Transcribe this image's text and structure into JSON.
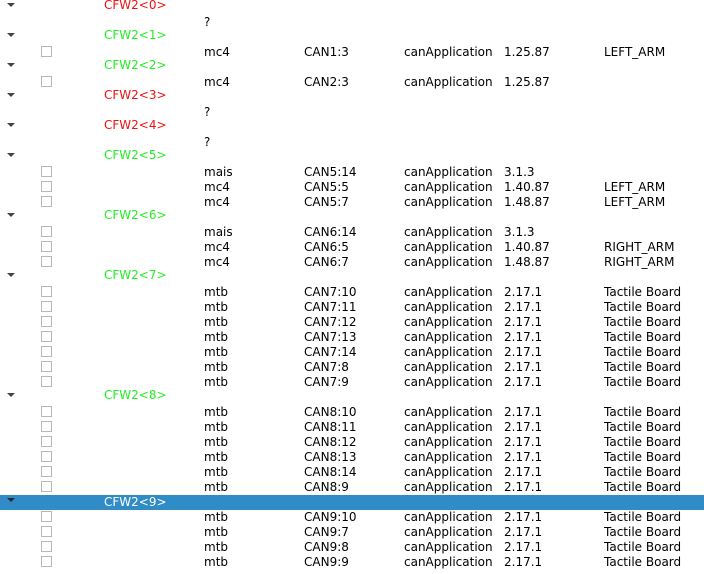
{
  "colors": {
    "group_ok": "#22ee22",
    "group_missing": "#ee1111",
    "selection": "#308cc6"
  },
  "groups": [
    {
      "label": "CFW2<0>",
      "status": "missing",
      "selected": false,
      "devices": [
        {
          "checkbox": false,
          "type": "?",
          "address": "",
          "application": "",
          "version": "",
          "name": ""
        }
      ]
    },
    {
      "label": "CFW2<1>",
      "status": "ok",
      "selected": false,
      "devices": [
        {
          "checkbox": true,
          "type": "mc4",
          "address": "CAN1:3",
          "application": "canApplication",
          "version": "1.25.87",
          "name": "LEFT_ARM"
        }
      ]
    },
    {
      "label": "CFW2<2>",
      "status": "ok",
      "selected": false,
      "devices": [
        {
          "checkbox": true,
          "type": "mc4",
          "address": "CAN2:3",
          "application": "canApplication",
          "version": "1.25.87",
          "name": ""
        }
      ]
    },
    {
      "label": "CFW2<3>",
      "status": "missing",
      "selected": false,
      "devices": [
        {
          "checkbox": false,
          "type": "?",
          "address": "",
          "application": "",
          "version": "",
          "name": ""
        }
      ]
    },
    {
      "label": "CFW2<4>",
      "status": "missing",
      "selected": false,
      "devices": [
        {
          "checkbox": false,
          "type": "?",
          "address": "",
          "application": "",
          "version": "",
          "name": ""
        }
      ]
    },
    {
      "label": "CFW2<5>",
      "status": "ok",
      "selected": false,
      "devices": [
        {
          "checkbox": true,
          "type": "mais",
          "address": "CAN5:14",
          "application": "canApplication",
          "version": "3.1.3",
          "name": ""
        },
        {
          "checkbox": true,
          "type": "mc4",
          "address": "CAN5:5",
          "application": "canApplication",
          "version": "1.40.87",
          "name": "LEFT_ARM"
        },
        {
          "checkbox": true,
          "type": "mc4",
          "address": "CAN5:7",
          "application": "canApplication",
          "version": "1.48.87",
          "name": "LEFT_ARM"
        }
      ]
    },
    {
      "label": "CFW2<6>",
      "status": "ok",
      "selected": false,
      "devices": [
        {
          "checkbox": true,
          "type": "mais",
          "address": "CAN6:14",
          "application": "canApplication",
          "version": "3.1.3",
          "name": ""
        },
        {
          "checkbox": true,
          "type": "mc4",
          "address": "CAN6:5",
          "application": "canApplication",
          "version": "1.40.87",
          "name": "RIGHT_ARM"
        },
        {
          "checkbox": true,
          "type": "mc4",
          "address": "CAN6:7",
          "application": "canApplication",
          "version": "1.48.87",
          "name": "RIGHT_ARM"
        }
      ]
    },
    {
      "label": "CFW2<7>",
      "status": "ok",
      "selected": false,
      "devices": [
        {
          "checkbox": true,
          "type": "mtb",
          "address": "CAN7:10",
          "application": "canApplication",
          "version": "2.17.1",
          "name": "Tactile Board"
        },
        {
          "checkbox": true,
          "type": "mtb",
          "address": "CAN7:11",
          "application": "canApplication",
          "version": "2.17.1",
          "name": "Tactile Board"
        },
        {
          "checkbox": true,
          "type": "mtb",
          "address": "CAN7:12",
          "application": "canApplication",
          "version": "2.17.1",
          "name": "Tactile Board"
        },
        {
          "checkbox": true,
          "type": "mtb",
          "address": "CAN7:13",
          "application": "canApplication",
          "version": "2.17.1",
          "name": "Tactile Board"
        },
        {
          "checkbox": true,
          "type": "mtb",
          "address": "CAN7:14",
          "application": "canApplication",
          "version": "2.17.1",
          "name": "Tactile Board"
        },
        {
          "checkbox": true,
          "type": "mtb",
          "address": "CAN7:8",
          "application": "canApplication",
          "version": "2.17.1",
          "name": "Tactile Board"
        },
        {
          "checkbox": true,
          "type": "mtb",
          "address": "CAN7:9",
          "application": "canApplication",
          "version": "2.17.1",
          "name": "Tactile Board"
        }
      ]
    },
    {
      "label": "CFW2<8>",
      "status": "ok",
      "selected": false,
      "devices": [
        {
          "checkbox": true,
          "type": "mtb",
          "address": "CAN8:10",
          "application": "canApplication",
          "version": "2.17.1",
          "name": "Tactile Board"
        },
        {
          "checkbox": true,
          "type": "mtb",
          "address": "CAN8:11",
          "application": "canApplication",
          "version": "2.17.1",
          "name": "Tactile Board"
        },
        {
          "checkbox": true,
          "type": "mtb",
          "address": "CAN8:12",
          "application": "canApplication",
          "version": "2.17.1",
          "name": "Tactile Board"
        },
        {
          "checkbox": true,
          "type": "mtb",
          "address": "CAN8:13",
          "application": "canApplication",
          "version": "2.17.1",
          "name": "Tactile Board"
        },
        {
          "checkbox": true,
          "type": "mtb",
          "address": "CAN8:14",
          "application": "canApplication",
          "version": "2.17.1",
          "name": "Tactile Board"
        },
        {
          "checkbox": true,
          "type": "mtb",
          "address": "CAN8:9",
          "application": "canApplication",
          "version": "2.17.1",
          "name": "Tactile Board"
        }
      ]
    },
    {
      "label": "CFW2<9>",
      "status": "ok",
      "selected": true,
      "devices": [
        {
          "checkbox": true,
          "type": "mtb",
          "address": "CAN9:10",
          "application": "canApplication",
          "version": "2.17.1",
          "name": "Tactile Board"
        },
        {
          "checkbox": true,
          "type": "mtb",
          "address": "CAN9:7",
          "application": "canApplication",
          "version": "2.17.1",
          "name": "Tactile Board"
        },
        {
          "checkbox": true,
          "type": "mtb",
          "address": "CAN9:8",
          "application": "canApplication",
          "version": "2.17.1",
          "name": "Tactile Board"
        },
        {
          "checkbox": true,
          "type": "mtb",
          "address": "CAN9:9",
          "application": "canApplication",
          "version": "2.17.1",
          "name": "Tactile Board"
        }
      ]
    }
  ]
}
